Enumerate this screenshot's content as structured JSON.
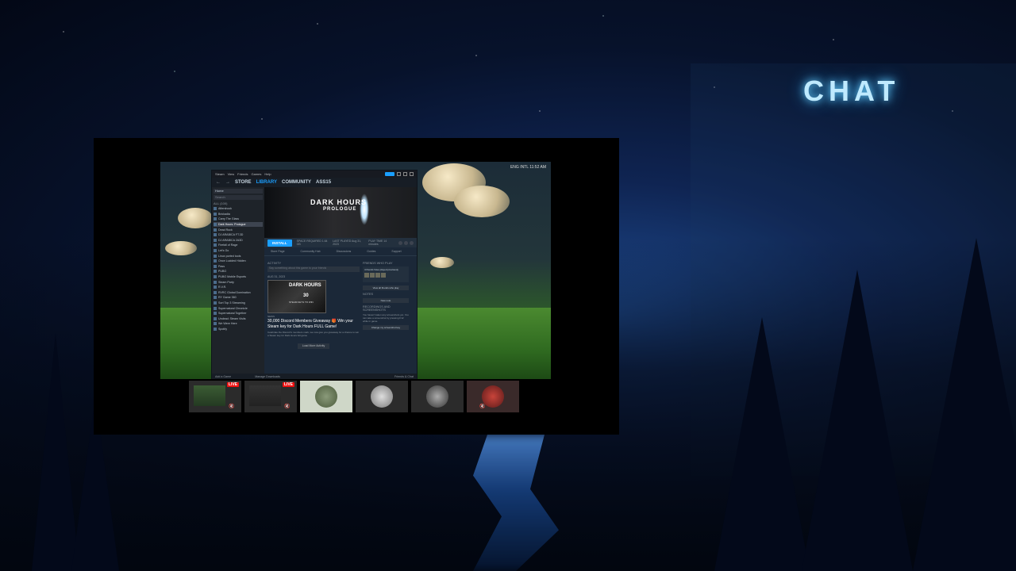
{
  "chat": {
    "title": "CHAT"
  },
  "tray": {
    "text": "ENG  INTL  11:52 AM"
  },
  "steam": {
    "top_menu": [
      "Steam",
      "View",
      "Friends",
      "Games",
      "Help"
    ],
    "nav": {
      "back": "←",
      "forward": "→",
      "tabs": [
        "STORE",
        "LIBRARY",
        "COMMUNITY",
        "ASS15"
      ],
      "active_tab": "LIBRARY"
    },
    "sidebar": {
      "home": "Home",
      "search_placeholder": "Search",
      "section": "ALL (100)",
      "items": [
        "Aftershock",
        "Brickadia",
        "Carry The Glass",
        "Dark Hours: Prologue",
        "Dead Rock",
        "DJ ARABICA FT.3D",
        "DJ ARABICA 2A3D",
        "Firefall of Rage",
        "Let's Go",
        "Linux ported tools",
        "Once Lucided Hidden",
        "Pass",
        "PUBG",
        "PUBG Mobile Esports",
        "Steam Party",
        "R.V.R.",
        "RVRC Global Domination",
        "RY Game 360",
        "Sort Top 3 Streaming",
        "Supernatural Chronicle",
        "Supernatural Together",
        "Undead: Steam Visits",
        "We Were Here",
        "Spotify"
      ],
      "selected_index": 3
    },
    "hero": {
      "title": "DARK HOURS",
      "subtitle": "PROLOGUE"
    },
    "action_bar": {
      "install": "INSTALL",
      "meta": [
        "SPACE REQUIRED 1.64 GB",
        "LAST PLAYED Aug 31, 2023",
        "PLAY TIME 14 minutes"
      ]
    },
    "subtabs": [
      "Store Page",
      "Community Hub",
      "Discussions",
      "Guides",
      "Support"
    ],
    "activity": {
      "label": "ACTIVITY",
      "placeholder": "Say something about this game to your friends",
      "date": "AUG 31, 2023",
      "news_img_title": "DARK HOURS",
      "news_img_num": "30",
      "news_img_caption": "STEAM KEYS TO WIN",
      "news_tag": "NEWS",
      "headline": "30,000 Discord Members Giveaway 🎁 Win your Steam key for Dark Hours FULL Game!",
      "body": "Celebrate the Discord's members mark, we now give you giveaway for a chance to win a Steam key for Dark Hours full game",
      "load_more": "Load More Activity"
    },
    "friends": {
      "label": "FRIENDS WHO PLAY",
      "text": "4 friends have played previously",
      "button": "View all friends who play"
    },
    "notes": {
      "label": "NOTES",
      "button": "New note"
    },
    "recordings": {
      "label": "RECORDINGS AND SCREENSHOTS",
      "text": "You haven't taken any screenshots yet. You can take a screenshot by pressing F12 while in game.",
      "button": "Change my screenshot key"
    },
    "bottom": {
      "add_game": "Add a Game",
      "downloads": "Manage Downloads",
      "friends_chat": "Friends & Chat"
    }
  },
  "thumbnails": [
    {
      "live_label": "LIVE",
      "mute": "🔇"
    },
    {
      "live_label": "LIVE",
      "mute": "🔇"
    },
    {},
    {},
    {},
    {
      "mute": "🔇"
    }
  ],
  "colors": {
    "accent": "#1a9fff",
    "chat_glow": "#6fd4ff",
    "live_red": "#ee1111"
  }
}
